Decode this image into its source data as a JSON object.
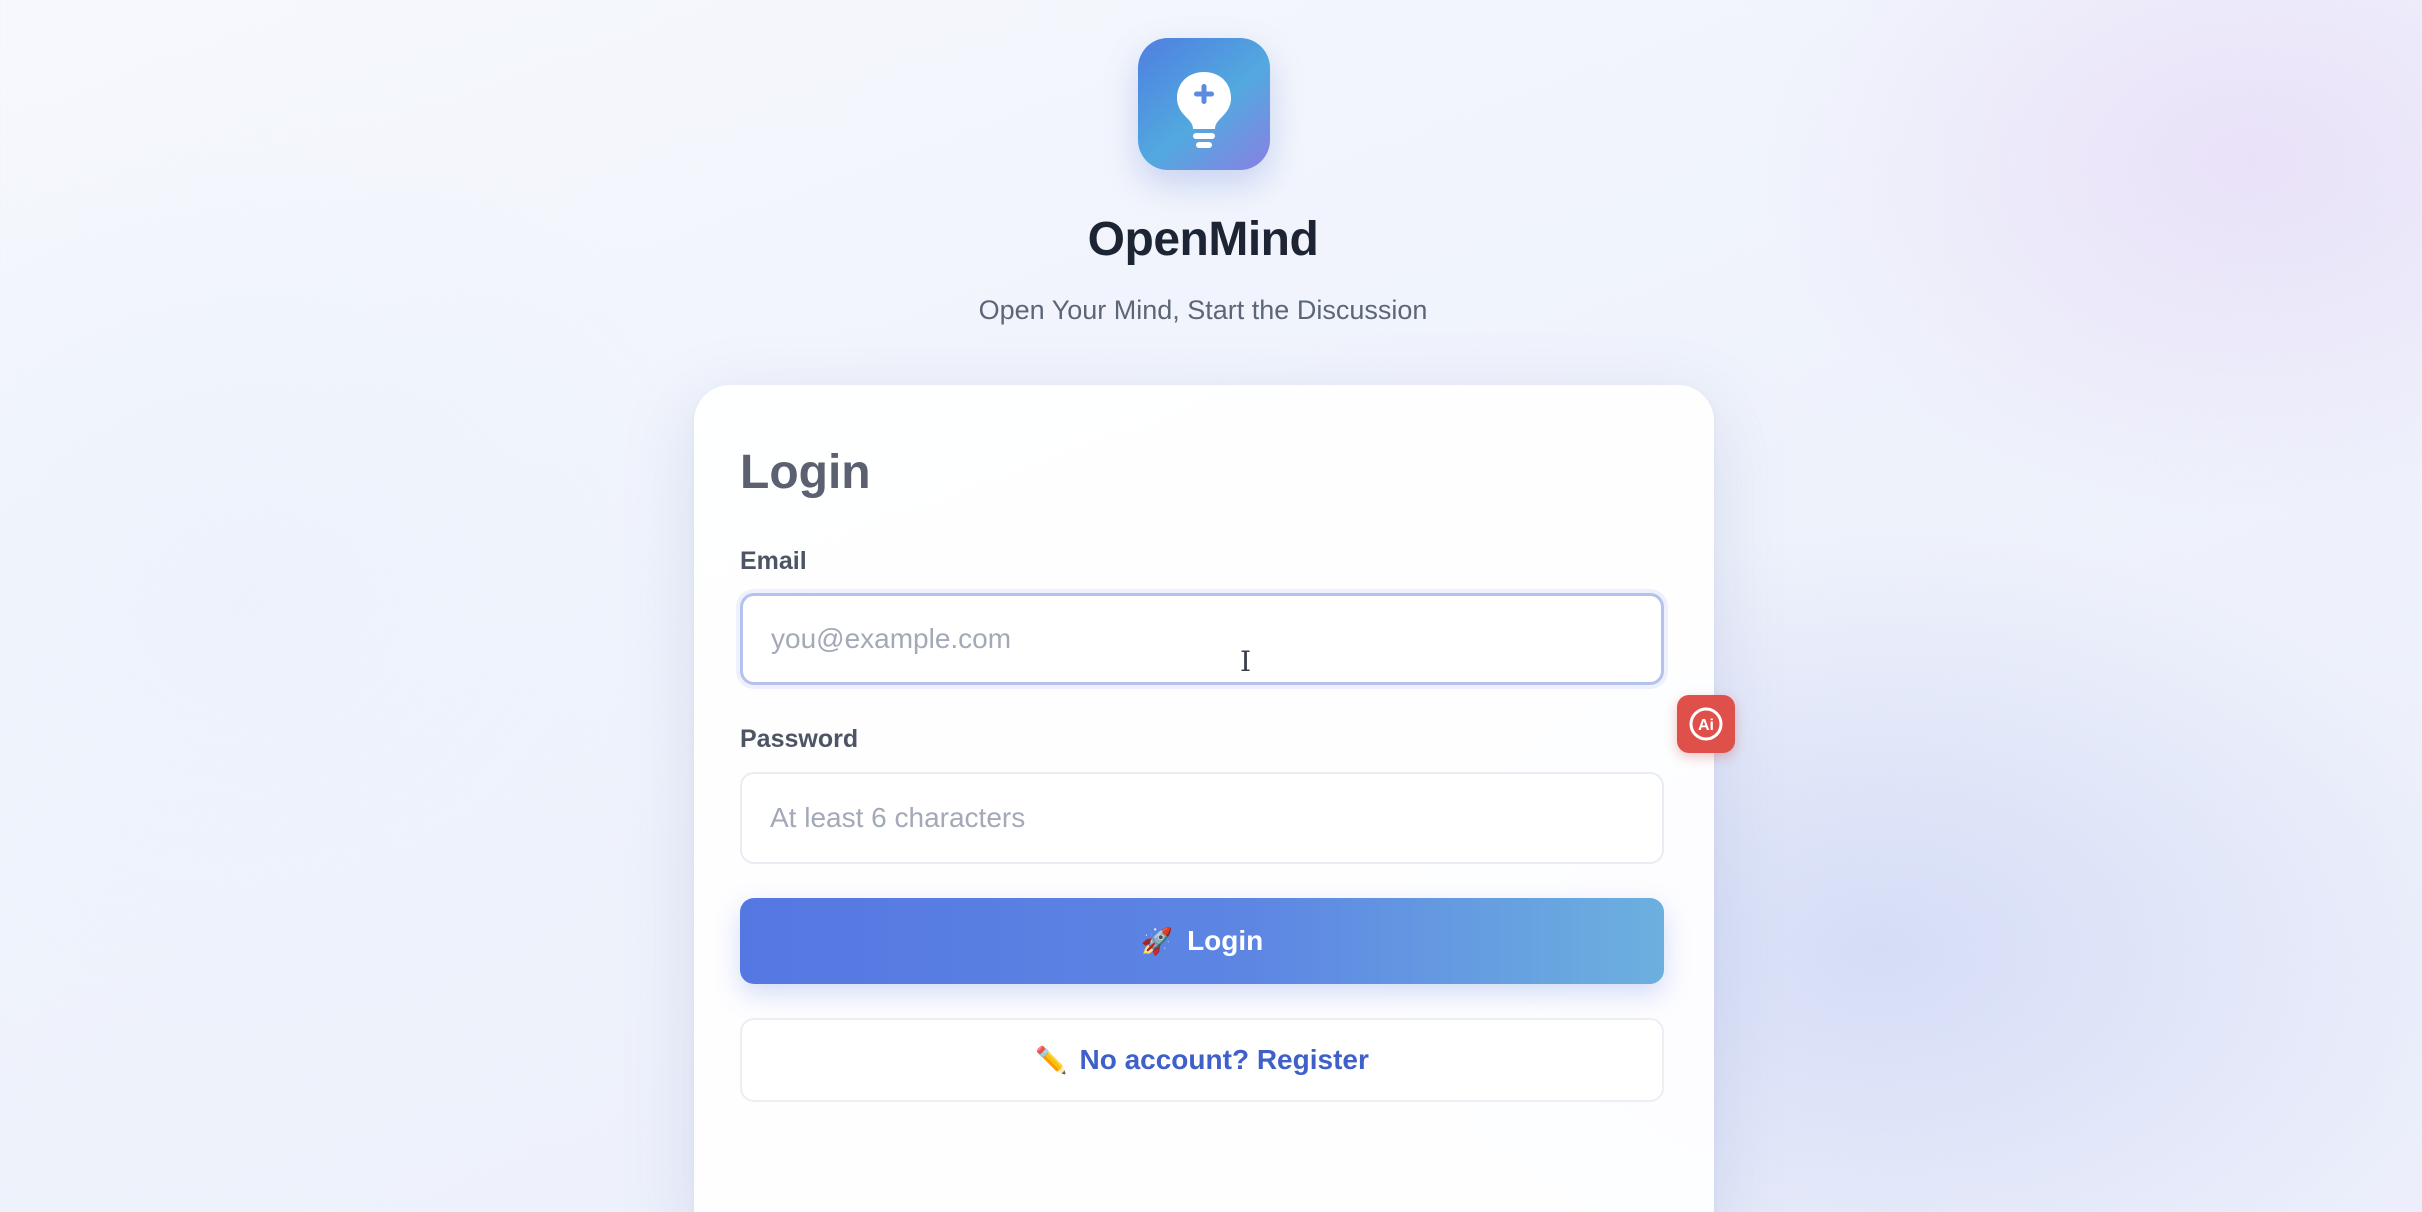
{
  "brand": {
    "name": "OpenMind",
    "tagline": "Open Your Mind, Start the Discussion",
    "logo_icon": "lightbulb-plus-icon"
  },
  "login_card": {
    "title": "Login",
    "email": {
      "label": "Email",
      "value": "",
      "placeholder": "you@example.com"
    },
    "password": {
      "label": "Password",
      "value": "",
      "placeholder": "At least 6 characters"
    },
    "login_button": {
      "icon": "🚀",
      "label": "Login"
    },
    "register_button": {
      "icon": "✏️",
      "label": "No account? Register"
    }
  },
  "floating_widget": {
    "icon": "ai-assistant-icon",
    "text": "Ai"
  },
  "colors": {
    "accent": "#5577e2",
    "accent_end": "#6cb0df",
    "link": "#3f5fc9",
    "widget": "#e0504b"
  }
}
